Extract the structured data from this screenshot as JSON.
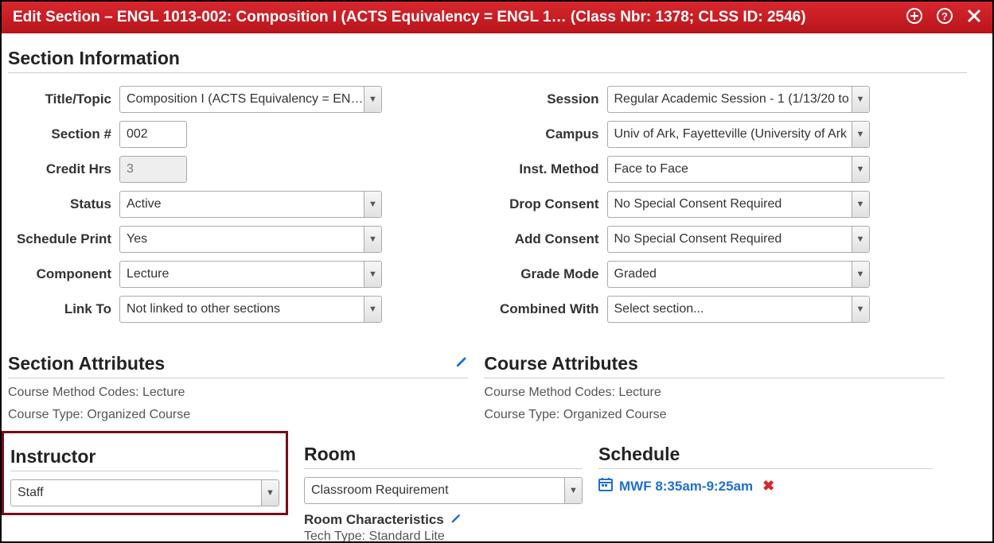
{
  "titlebar": {
    "text": "Edit Section – ENGL 1013-002: Composition I (ACTS Equivalency = ENGL 1… (Class Nbr: 1378; CLSS ID: 2546)"
  },
  "section_info_heading": "Section Information",
  "left": {
    "title_label": "Title/Topic",
    "title_value": "Composition I (ACTS Equivalency = ENGL",
    "section_label": "Section #",
    "section_value": "002",
    "credit_label": "Credit Hrs",
    "credit_value": "3",
    "status_label": "Status",
    "status_value": "Active",
    "sched_print_label": "Schedule Print",
    "sched_print_value": "Yes",
    "component_label": "Component",
    "component_value": "Lecture",
    "linkto_label": "Link To",
    "linkto_value": "Not linked to other sections"
  },
  "right": {
    "session_label": "Session",
    "session_value": "Regular Academic Session - 1 (1/13/20 to",
    "campus_label": "Campus",
    "campus_value": "Univ of Ark, Fayetteville (University of Ark",
    "inst_method_label": "Inst. Method",
    "inst_method_value": "Face to Face",
    "drop_consent_label": "Drop Consent",
    "drop_consent_value": "No Special Consent Required",
    "add_consent_label": "Add Consent",
    "add_consent_value": "No Special Consent Required",
    "grade_mode_label": "Grade Mode",
    "grade_mode_value": "Graded",
    "combined_label": "Combined With",
    "combined_value": "Select section..."
  },
  "section_attributes": {
    "heading": "Section Attributes",
    "line1": "Course Method Codes: Lecture",
    "line2": "Course Type: Organized Course"
  },
  "course_attributes": {
    "heading": "Course Attributes",
    "line1": "Course Method Codes: Lecture",
    "line2": "Course Type: Organized Course"
  },
  "instructor": {
    "heading": "Instructor",
    "value": "Staff"
  },
  "room": {
    "heading": "Room",
    "value": "Classroom Requirement",
    "char_heading": "Room Characteristics",
    "char_value": "Tech Type: Standard Lite"
  },
  "schedule": {
    "heading": "Schedule",
    "value": "MWF 8:35am-9:25am"
  }
}
